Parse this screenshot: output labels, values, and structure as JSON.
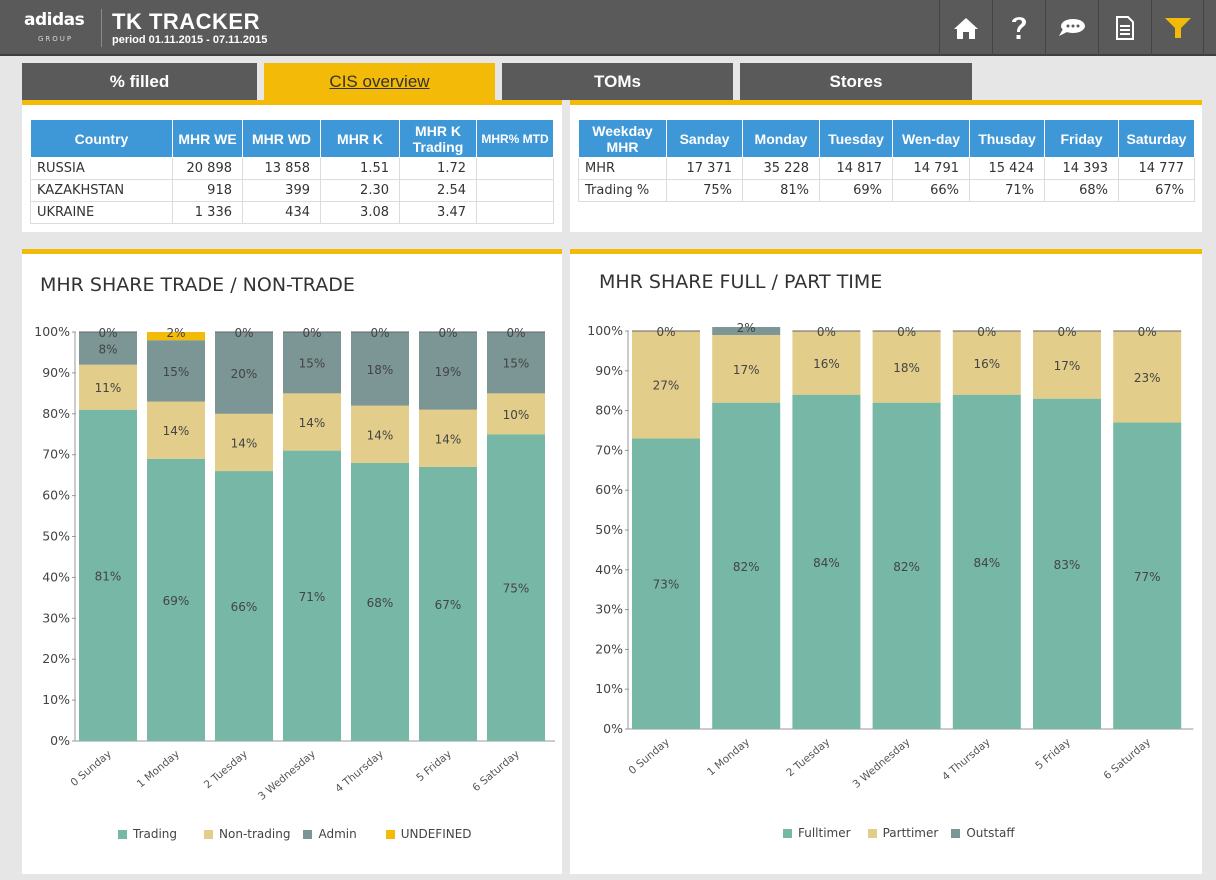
{
  "header": {
    "logo_name": "adidas",
    "logo_group": "GROUP",
    "title": "TK TRACKER",
    "period": "period 01.11.2015 - 07.11.2015",
    "buttons": [
      "home-icon",
      "help-icon",
      "chat-icon",
      "document-icon",
      "filter-icon"
    ]
  },
  "tabs": [
    {
      "label": "% filled",
      "active": false
    },
    {
      "label": "CIS overview",
      "active": true
    },
    {
      "label": "TOMs",
      "active": false
    },
    {
      "label": "Stores",
      "active": false
    }
  ],
  "colors": {
    "accent": "#f3bb07",
    "header": "#5a5a5a",
    "table_header": "#3e97d6",
    "trading": "#76b7a5",
    "nontrading": "#e2cd8b",
    "admin": "#7b9694",
    "undefined": "#f3bb07"
  },
  "country_table": {
    "headers": [
      "Country",
      "MHR WE",
      "MHR WD",
      "MHR K",
      "MHR K Trading",
      "MHR% MTD"
    ],
    "rows": [
      [
        "RUSSIA",
        "20 898",
        "13 858",
        "1.51",
        "1.72",
        ""
      ],
      [
        "KAZAKHSTAN",
        "918",
        "399",
        "2.30",
        "2.54",
        ""
      ],
      [
        "UKRAINE",
        "1 336",
        "434",
        "3.08",
        "3.47",
        ""
      ]
    ]
  },
  "weekday_table": {
    "headers": [
      "Weekday MHR",
      "Sanday",
      "Monday",
      "Tuesday",
      "Wen-day",
      "Thusday",
      "Friday",
      "Saturday"
    ],
    "rows": [
      [
        "MHR",
        "17 371",
        "35 228",
        "14 817",
        "14 791",
        "15 424",
        "14 393",
        "14 777"
      ],
      [
        "Trading %",
        "75%",
        "81%",
        "69%",
        "66%",
        "71%",
        "68%",
        "67%"
      ]
    ]
  },
  "chart_data": [
    {
      "type": "bar",
      "stacked": true,
      "title": "MHR SHARE TRADE / NON-TRADE",
      "categories": [
        "0 Sunday",
        "1 Monday",
        "2 Tuesday",
        "3 Wednesday",
        "4 Thursday",
        "5 Friday",
        "6 Saturday"
      ],
      "yticks": [
        "0%",
        "10%",
        "20%",
        "30%",
        "40%",
        "50%",
        "60%",
        "70%",
        "80%",
        "90%",
        "100%"
      ],
      "ylim": [
        0,
        100
      ],
      "legend_position": "bottom",
      "series": [
        {
          "name": "Trading",
          "color": "#76b7a5",
          "values": [
            81,
            69,
            66,
            71,
            68,
            67,
            75
          ],
          "labels": [
            "81%",
            "69%",
            "66%",
            "71%",
            "68%",
            "67%",
            "75%"
          ]
        },
        {
          "name": "Non-trading",
          "color": "#e2cd8b",
          "values": [
            11,
            14,
            14,
            14,
            14,
            14,
            10
          ],
          "labels": [
            "11%",
            "14%",
            "14%",
            "14%",
            "14%",
            "14%",
            "10%"
          ]
        },
        {
          "name": "Admin",
          "color": "#7b9694",
          "values": [
            8,
            15,
            20,
            15,
            18,
            19,
            15
          ],
          "labels": [
            "8%",
            "15%",
            "20%",
            "15%",
            "18%",
            "19%",
            "15%"
          ]
        },
        {
          "name": "UNDEFINED",
          "color": "#f3bb07",
          "values": [
            0,
            2,
            0,
            0,
            0,
            0,
            0
          ],
          "labels": [
            "0%",
            "2%",
            "0%",
            "0%",
            "0%",
            "0%",
            "0%"
          ]
        }
      ]
    },
    {
      "type": "bar",
      "stacked": true,
      "title": "MHR SHARE FULL / PART TIME",
      "categories": [
        "0 Sunday",
        "1 Monday",
        "2 Tuesday",
        "3 Wednesday",
        "4 Thursday",
        "5 Friday",
        "6 Saturday"
      ],
      "yticks": [
        "0%",
        "10%",
        "20%",
        "30%",
        "40%",
        "50%",
        "60%",
        "70%",
        "80%",
        "90%",
        "100%"
      ],
      "ylim": [
        0,
        100
      ],
      "legend_position": "bottom",
      "series": [
        {
          "name": "Fulltimer",
          "color": "#76b7a5",
          "values": [
            73,
            82,
            84,
            82,
            84,
            83,
            77
          ],
          "labels": [
            "73%",
            "82%",
            "84%",
            "82%",
            "84%",
            "83%",
            "77%"
          ]
        },
        {
          "name": "Parttimer",
          "color": "#e2cd8b",
          "values": [
            27,
            17,
            16,
            18,
            16,
            17,
            23
          ],
          "labels": [
            "27%",
            "17%",
            "16%",
            "18%",
            "16%",
            "17%",
            "23%"
          ]
        },
        {
          "name": "Outstaff",
          "color": "#7b9694",
          "values": [
            0,
            2,
            0,
            0,
            0,
            0,
            0
          ],
          "labels": [
            "0%",
            "2%",
            "0%",
            "0%",
            "0%",
            "0%",
            "0%"
          ]
        }
      ]
    }
  ]
}
